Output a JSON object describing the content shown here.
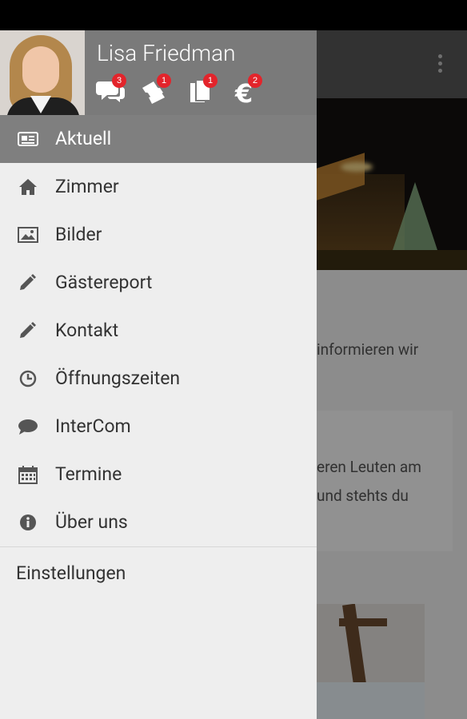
{
  "user": {
    "name": "Lisa Friedman"
  },
  "badges": [
    {
      "icon": "chat-bubbles-icon",
      "count": "3"
    },
    {
      "icon": "tickets-icon",
      "count": "1"
    },
    {
      "icon": "documents-icon",
      "count": "1"
    },
    {
      "icon": "euro-icon",
      "count": "2"
    }
  ],
  "menu": {
    "items": [
      {
        "label": "Aktuell",
        "icon": "newspaper-icon"
      },
      {
        "label": "Zimmer",
        "icon": "home-icon"
      },
      {
        "label": "Bilder",
        "icon": "picture-icon"
      },
      {
        "label": "Gästereport",
        "icon": "pencil-icon"
      },
      {
        "label": "Kontakt",
        "icon": "pencil-icon"
      },
      {
        "label": "Öffnungszeiten",
        "icon": "clock-icon"
      },
      {
        "label": "InterCom",
        "icon": "speech-bubble-icon"
      },
      {
        "label": "Termine",
        "icon": "calendar-icon"
      },
      {
        "label": "Über uns",
        "icon": "info-icon"
      }
    ],
    "settings_label": "Einstellungen"
  },
  "background": {
    "text_1": "informieren wir",
    "text_2": "eren Leuten am",
    "text_3": "und stehts du"
  },
  "colors": {
    "drawer_bg": "#eeeeee",
    "profile_bg": "#7a7a7a",
    "active_item_bg": "#7f7f7f",
    "badge_red": "#e3242b"
  }
}
